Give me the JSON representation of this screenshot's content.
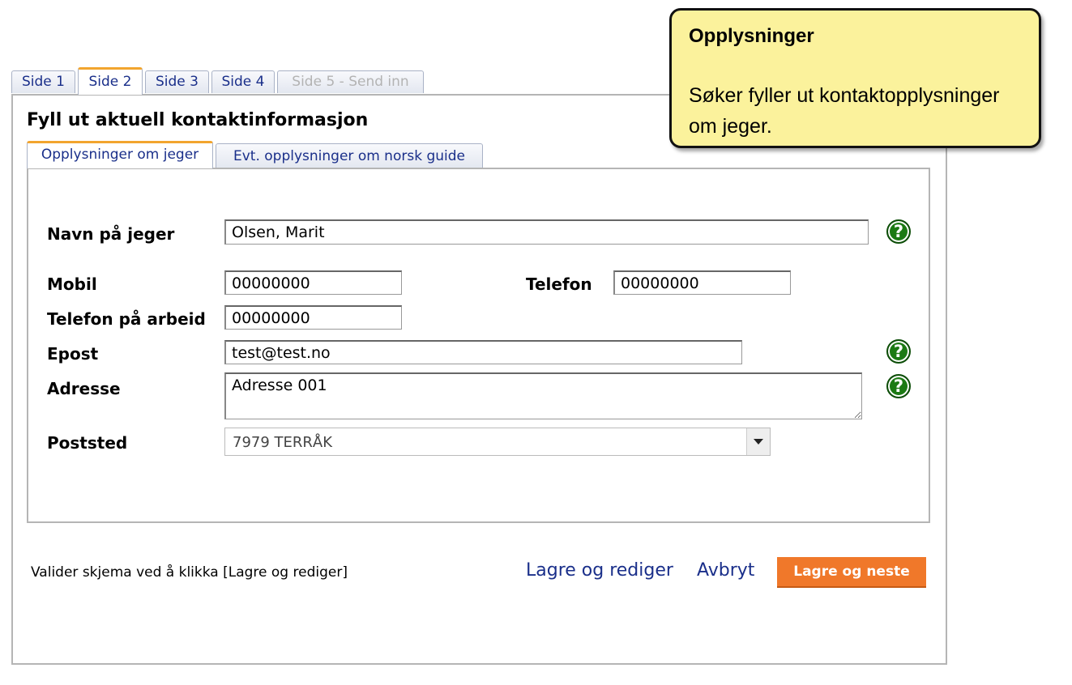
{
  "page_tabs": [
    {
      "label": "Side 1",
      "state": "normal"
    },
    {
      "label": "Side 2",
      "state": "active"
    },
    {
      "label": "Side 3",
      "state": "normal"
    },
    {
      "label": "Side 4",
      "state": "normal"
    },
    {
      "label": "Side 5 - Send inn",
      "state": "disabled"
    }
  ],
  "panel_title": "Fyll ut aktuell kontaktinformasjon",
  "sub_tabs": [
    {
      "label": "Opplysninger om jeger",
      "state": "active"
    },
    {
      "label": "Evt. opplysninger om norsk guide",
      "state": "normal"
    }
  ],
  "form": {
    "name": {
      "label": "Navn på jeger",
      "value": "Olsen, Marit"
    },
    "mobile": {
      "label": "Mobil",
      "value": "00000000"
    },
    "phone": {
      "label": "Telefon",
      "value": "00000000"
    },
    "work_phone": {
      "label": "Telefon på arbeid",
      "value": "00000000"
    },
    "email": {
      "label": "Epost",
      "value": "test@test.no"
    },
    "address": {
      "label": "Adresse",
      "value": "Adresse 001"
    },
    "postal": {
      "label": "Poststed",
      "value": "7979 TERRÅK"
    },
    "help_symbol": "?"
  },
  "footer": {
    "hint": "Valider skjema ved å klikka [Lagre og rediger]",
    "save_edit": "Lagre og rediger",
    "cancel": "Avbryt",
    "save_next": "Lagre og neste"
  },
  "callout": {
    "title": "Opplysninger",
    "body": "Søker fyller ut kontaktopplysninger om jeger."
  },
  "colors": {
    "accent_orange": "#f0782a",
    "link_blue": "#1a2f8a",
    "help_green": "#1c7a14",
    "callout_yellow": "#fbf29c"
  }
}
